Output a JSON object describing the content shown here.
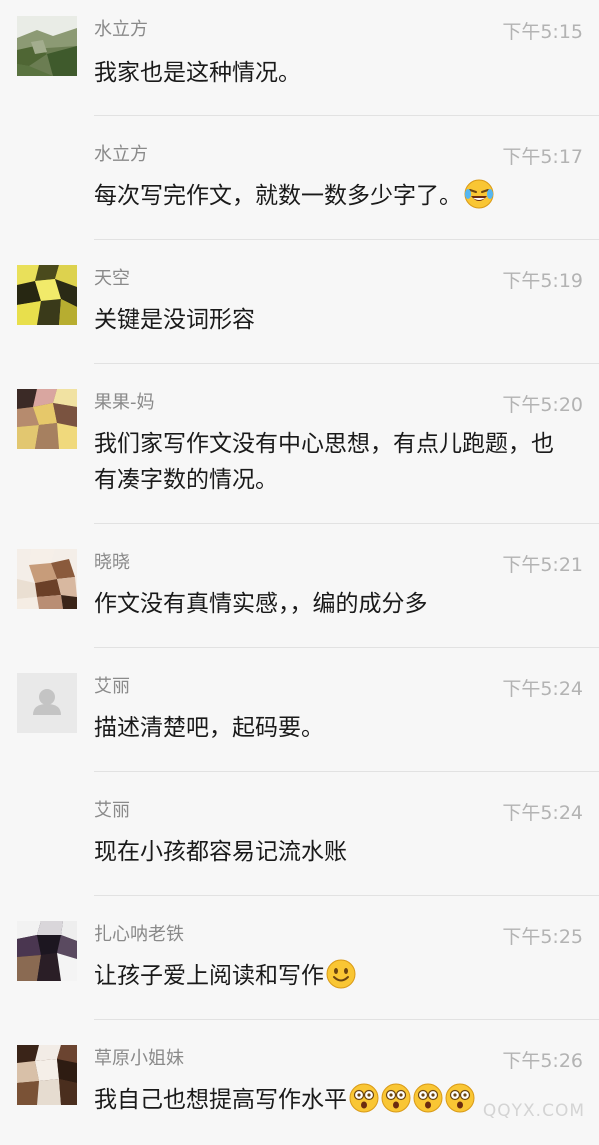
{
  "comments": [
    {
      "name": "水立方",
      "time": "下午5:15",
      "text": "我家也是这种情况。",
      "avatar": "avatar-landscape",
      "emoji": ""
    },
    {
      "name": "水立方",
      "time": "下午5:17",
      "text": "每次写完作文，就数一数多少字了。",
      "avatar": "",
      "emoji": "crying-laughing-emoji"
    },
    {
      "name": "天空",
      "time": "下午5:19",
      "text": "关键是没词形容",
      "avatar": "avatar-yellow",
      "emoji": ""
    },
    {
      "name": "果果-妈",
      "time": "下午5:20",
      "text": "我们家写作文没有中心思想，有点儿跑题，也有凑字数的情况。",
      "avatar": "avatar-brown-yellow",
      "emoji": ""
    },
    {
      "name": "晓晓",
      "time": "下午5:21",
      "text": "作文没有真情实感，，编的成分多",
      "avatar": "avatar-tan",
      "emoji": ""
    },
    {
      "name": "艾丽",
      "time": "下午5:24",
      "text": "描述清楚吧，起码要。",
      "avatar": "avatar-default-person",
      "emoji": ""
    },
    {
      "name": "艾丽",
      "time": "下午5:24",
      "text": "现在小孩都容易记流水账",
      "avatar": "",
      "emoji": ""
    },
    {
      "name": "扎心呐老铁",
      "time": "下午5:25",
      "text": "让孩子爱上阅读和写作",
      "avatar": "avatar-dark",
      "emoji": "smile-emoji"
    },
    {
      "name": "草原小姐妹",
      "time": "下午5:26",
      "text": "我自己也想提高写作水平",
      "avatar": "avatar-brown",
      "emoji": "astonished-emoji x4"
    }
  ],
  "watermark": "QQYX.COM",
  "colors": {
    "background": "#f7f7f7",
    "name": "#8a8a8a",
    "time": "#b3b3b3",
    "text": "#1a1a1a",
    "divider": "#e2e2e2"
  }
}
